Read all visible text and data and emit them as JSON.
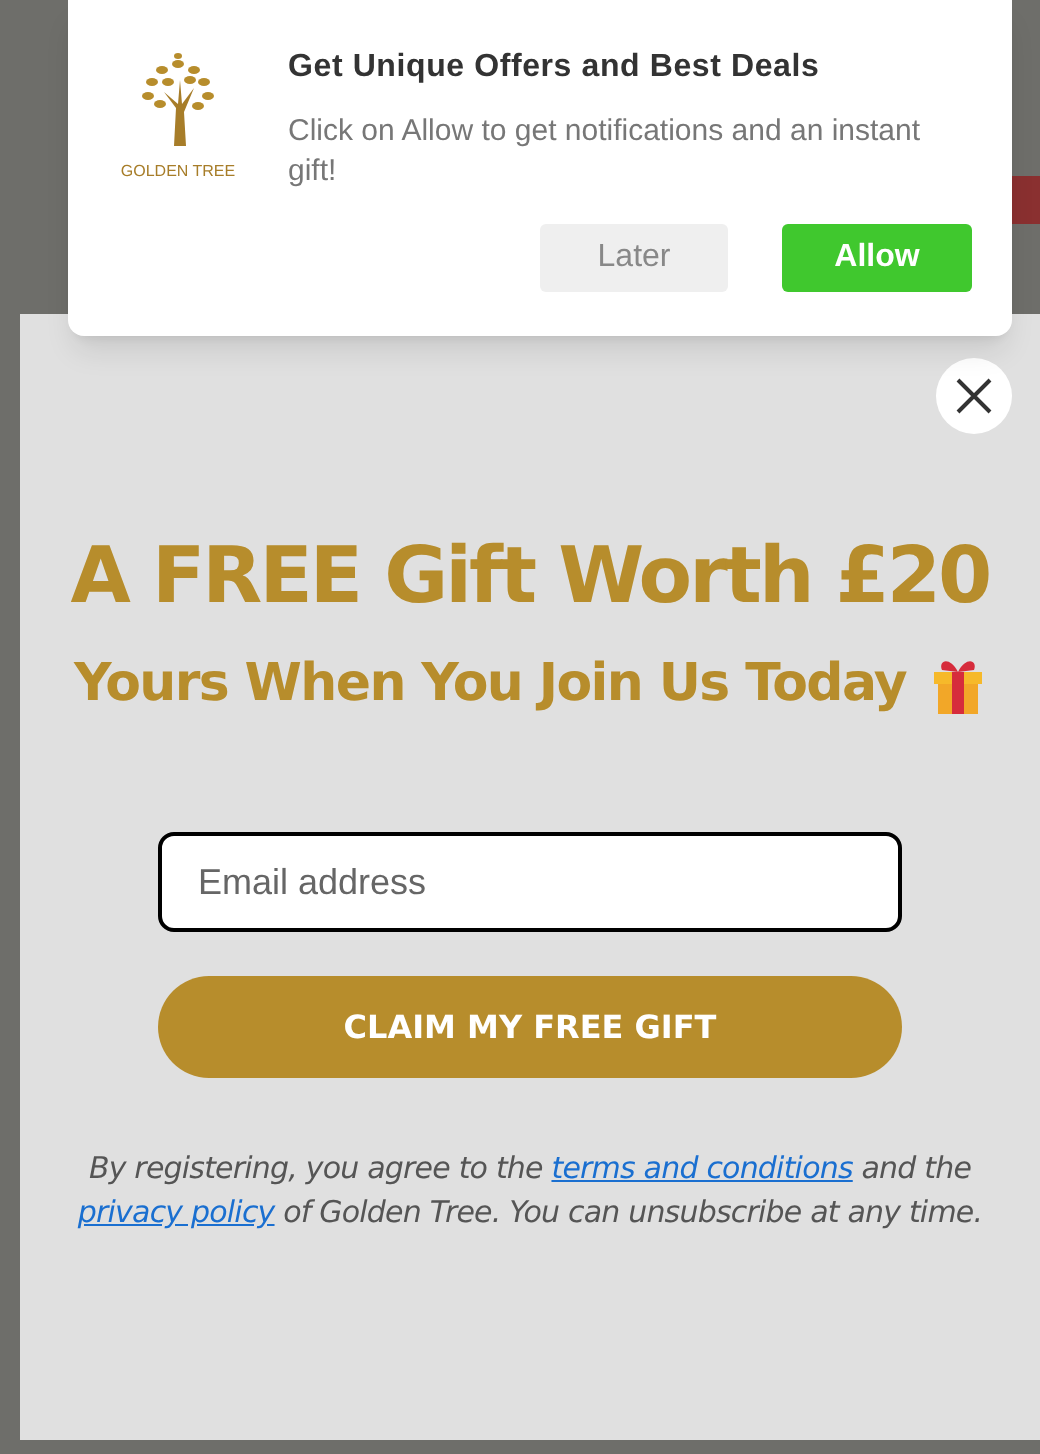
{
  "notification": {
    "logo_text": "GOLDEN TREE",
    "title": "Get Unique Offers and Best Deals",
    "message": "Click on Allow to get notifications and an instant gift!",
    "buttons": [
      {
        "label": "Later",
        "kind": "secondary"
      },
      {
        "label": "Allow",
        "kind": "primary"
      }
    ]
  },
  "popup": {
    "headline": "A FREE Gift Worth £20",
    "subheadline": "Yours When You Join Us Today",
    "email": {
      "placeholder": "Email address"
    },
    "submit": "CLAIM MY FREE GIFT",
    "disclaimer": [
      {
        "text": "By registering, you agree to the ",
        "kind": "text"
      },
      {
        "text": "terms and conditions",
        "kind": "link"
      },
      {
        "text": " and the ",
        "kind": "text"
      },
      {
        "text": "privacy policy",
        "kind": "link"
      },
      {
        "text": " of Golden Tree. You can unsubscribe at any time.",
        "kind": "text"
      }
    ]
  }
}
